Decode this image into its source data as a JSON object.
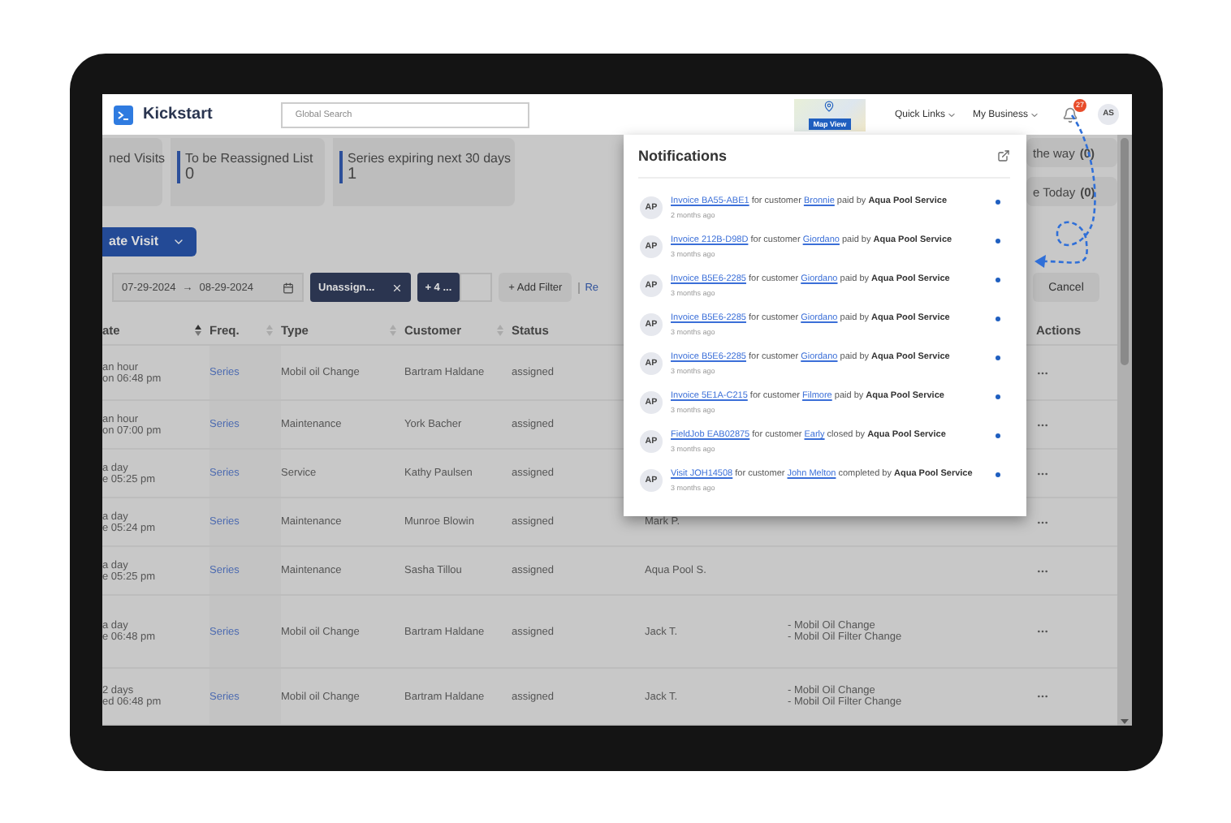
{
  "header": {
    "logo": "Kickstart",
    "search": {
      "placeholder": "Global Search"
    },
    "map_button": "Map View",
    "menus": [
      "Quick Links",
      "My Business"
    ],
    "notification_count": "27",
    "avatar": "AS"
  },
  "stats": [
    {
      "label": "ned Visits"
    },
    {
      "label": "To be Reassigned List",
      "value": "0"
    },
    {
      "label": "Series expiring next 30 days",
      "value": "1"
    }
  ],
  "stats_right": [
    "the way **(0)**",
    "e Today **(0)**"
  ],
  "create_button": "ate Visit",
  "filters": {
    "date_from": "07-29-2024",
    "date_separator": "→",
    "date_to": "08-29-2024",
    "chips": [
      {
        "label": "Unassign...",
        "removable": true
      },
      {
        "label": "+ 4 ...",
        "removable": false
      }
    ],
    "add_filter": "+ Add Filter",
    "reset": "Re",
    "cancel": "Cancel"
  },
  "table": {
    "columns": [
      {
        "label": "ate",
        "sortable": true,
        "sorted": true
      },
      {
        "label": "Freq.",
        "sortable": true,
        "sorted": false
      },
      {
        "label": "Type",
        "sortable": true,
        "sorted": false
      },
      {
        "label": "Customer",
        "sortable": true,
        "sorted": false
      },
      {
        "label": "Status"
      },
      {
        "label": "Actions"
      }
    ],
    "rows": [
      {
        "date": [
          "an hour",
          "on 06:48 pm"
        ],
        "freq": "Series",
        "type": "Mobil oil Change",
        "customer": "Bartram Haldane",
        "status": "assigned"
      },
      {
        "date": [
          "an hour",
          "on 07:00 pm"
        ],
        "freq": "Series",
        "type": "Maintenance",
        "customer": "York Bacher",
        "status": "assigned"
      },
      {
        "date": [
          "a day",
          "e 05:25 pm"
        ],
        "freq": "Series",
        "type": "Service",
        "customer": "Kathy Paulsen",
        "status": "assigned"
      },
      {
        "date": [
          "a day",
          "e 05:24 pm"
        ],
        "freq": "Series",
        "type": "Maintenance",
        "customer": "Munroe Blowin",
        "status": "assigned",
        "technician": "Mark P."
      },
      {
        "date": [
          "a day",
          "e 05:25 pm"
        ],
        "freq": "Series",
        "type": "Maintenance",
        "customer": "Sasha Tillou",
        "status": "assigned",
        "technician": "Aqua Pool S."
      },
      {
        "date": [
          "a day",
          "e 06:48 pm"
        ],
        "freq": "Series",
        "type": "Mobil oil Change",
        "customer": "Bartram Haldane",
        "status": "assigned",
        "technician": "Jack T.",
        "services": [
          "- Mobil Oil Change",
          "- Mobil Oil Filter Change"
        ]
      },
      {
        "date": [
          "2 days",
          "ed 06:48 pm"
        ],
        "freq": "Series",
        "type": "Mobil oil Change",
        "customer": "Bartram Haldane",
        "status": "assigned",
        "technician": "Jack T.",
        "services": [
          "- Mobil Oil Change",
          "- Mobil Oil Filter Change"
        ]
      }
    ]
  },
  "notifications": {
    "title": "Notifications",
    "items": [
      {
        "avatar": "AP",
        "parts": [
          {
            "kind": "link",
            "text": "Invoice BA55-ABE1"
          },
          {
            "kind": "text",
            "text": " for customer "
          },
          {
            "kind": "link",
            "text": "Bronnie"
          },
          {
            "kind": "text",
            "text": " paid by **Aqua Pool Service**"
          }
        ],
        "time": "2 months ago",
        "unread": true
      },
      {
        "avatar": "AP",
        "parts": [
          {
            "kind": "link",
            "text": "Invoice 212B-D98D"
          },
          {
            "kind": "text",
            "text": " for customer "
          },
          {
            "kind": "link",
            "text": "Giordano"
          },
          {
            "kind": "text",
            "text": " paid by **Aqua Pool Service**"
          }
        ],
        "time": "3 months ago",
        "unread": true
      },
      {
        "avatar": "AP",
        "parts": [
          {
            "kind": "link",
            "text": "Invoice B5E6-2285"
          },
          {
            "kind": "text",
            "text": " for customer "
          },
          {
            "kind": "link",
            "text": "Giordano"
          },
          {
            "kind": "text",
            "text": " paid by **Aqua Pool Service**"
          }
        ],
        "time": "3 months ago",
        "unread": true
      },
      {
        "avatar": "AP",
        "parts": [
          {
            "kind": "link",
            "text": "Invoice B5E6-2285"
          },
          {
            "kind": "text",
            "text": " for customer "
          },
          {
            "kind": "link",
            "text": "Giordano"
          },
          {
            "kind": "text",
            "text": " paid by **Aqua Pool Service**"
          }
        ],
        "time": "3 months ago",
        "unread": true
      },
      {
        "avatar": "AP",
        "parts": [
          {
            "kind": "link",
            "text": "Invoice B5E6-2285"
          },
          {
            "kind": "text",
            "text": " for customer "
          },
          {
            "kind": "link",
            "text": "Giordano"
          },
          {
            "kind": "text",
            "text": " paid by **Aqua Pool Service**"
          }
        ],
        "time": "3 months ago",
        "unread": true
      },
      {
        "avatar": "AP",
        "parts": [
          {
            "kind": "link",
            "text": "Invoice 5E1A-C215"
          },
          {
            "kind": "text",
            "text": " for customer "
          },
          {
            "kind": "link",
            "text": "Filmore"
          },
          {
            "kind": "text",
            "text": " paid by **Aqua Pool Service**"
          }
        ],
        "time": "3 months ago",
        "unread": true
      },
      {
        "avatar": "AP",
        "parts": [
          {
            "kind": "link",
            "text": "FieldJob EAB02875"
          },
          {
            "kind": "text",
            "text": " for customer "
          },
          {
            "kind": "link",
            "text": "Early"
          },
          {
            "kind": "text",
            "text": " closed by **Aqua Pool Service**"
          }
        ],
        "time": "3 months ago",
        "unread": true
      },
      {
        "avatar": "AP",
        "parts": [
          {
            "kind": "link",
            "text": "Visit JOH14508"
          },
          {
            "kind": "text",
            "text": " for customer "
          },
          {
            "kind": "link",
            "text": "John Melton"
          },
          {
            "kind": "text",
            "text": " completed by **Aqua Pool Service**"
          }
        ],
        "time": "3 months ago",
        "unread": true
      }
    ]
  }
}
